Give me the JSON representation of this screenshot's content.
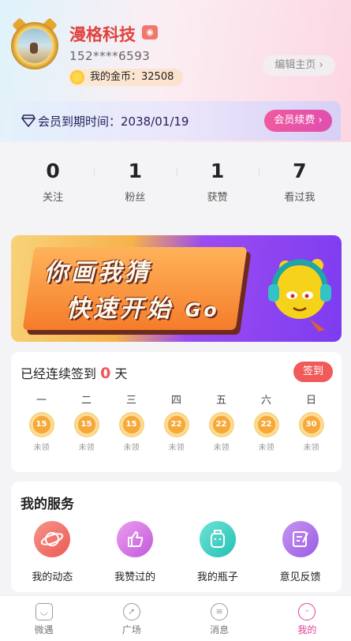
{
  "profile": {
    "name": "漫格科技",
    "phone": "152****6593",
    "coins_label": "我的金币：32508",
    "edit_button": "编辑主页 ›"
  },
  "vip": {
    "expire_text": "会员到期时间：2038/01/19",
    "renew_button": "会员续费 ›"
  },
  "stats": [
    {
      "value": "0",
      "label": "关注"
    },
    {
      "value": "1",
      "label": "粉丝"
    },
    {
      "value": "1",
      "label": "获赞"
    },
    {
      "value": "7",
      "label": "看过我"
    }
  ],
  "banner": {
    "line1": "你画我猜",
    "line2": "快速开始",
    "go": "Go"
  },
  "signin": {
    "title_prefix": "已经连续签到",
    "days": "0",
    "title_suffix": "天",
    "button": "签到",
    "week": [
      {
        "day": "一",
        "coins": "15",
        "status": "未领"
      },
      {
        "day": "二",
        "coins": "15",
        "status": "未领"
      },
      {
        "day": "三",
        "coins": "15",
        "status": "未领"
      },
      {
        "day": "四",
        "coins": "22",
        "status": "未领"
      },
      {
        "day": "五",
        "coins": "22",
        "status": "未领"
      },
      {
        "day": "六",
        "coins": "22",
        "status": "未领"
      },
      {
        "day": "日",
        "coins": "30",
        "status": "未领"
      }
    ]
  },
  "services": {
    "title": "我的服务",
    "items": [
      {
        "label": "我的动态",
        "icon": "planet-icon",
        "color": "#f0645f"
      },
      {
        "label": "我赞过的",
        "icon": "thumbs-up-icon",
        "color": "#d66fe2"
      },
      {
        "label": "我的瓶子",
        "icon": "bottle-icon",
        "color": "#33cdbf"
      },
      {
        "label": "意见反馈",
        "icon": "feedback-icon",
        "color": "#a66de6"
      }
    ]
  },
  "tabbar": [
    {
      "label": "微遇",
      "icon": "home-icon"
    },
    {
      "label": "广场",
      "icon": "compass-icon"
    },
    {
      "label": "消息",
      "icon": "message-icon"
    },
    {
      "label": "我的",
      "icon": "profile-icon",
      "active": true
    }
  ],
  "colors": {
    "accent": "#e0409a",
    "name": "#e2413d",
    "sign_button": "#f05a5a"
  }
}
